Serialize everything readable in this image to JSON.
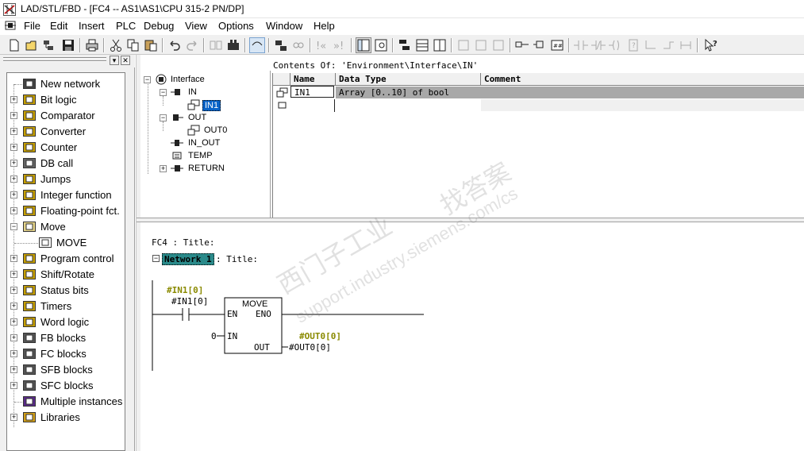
{
  "window": {
    "title": "LAD/STL/FBD  - [FC4 -- AS1\\AS1\\CPU 315-2 PN/DP]",
    "icon": "ladder-app-icon"
  },
  "menu": [
    "File",
    "Edit",
    "Insert",
    "PLC",
    "Debug",
    "View",
    "Options",
    "Window",
    "Help"
  ],
  "toolbar": {
    "icons": [
      "new-icon",
      "open-icon",
      "network-open-icon",
      "save-icon",
      "print-icon",
      "cut-icon",
      "copy-icon",
      "paste-icon",
      "undo-icon",
      "redo-icon",
      "load-icon",
      "station-icon",
      "monitor-icon",
      "online-icon",
      "offline-icon",
      "program-elements-icon",
      "overview-icon",
      "details-icon",
      "split-icon",
      "network-insert-icon",
      "branch-icon",
      "contact-no-icon",
      "contact-nc-icon",
      "coil-icon",
      "box-icon",
      "branch-open-icon",
      "branch-close-icon",
      "help-cursor-icon"
    ]
  },
  "catalog": {
    "items": [
      {
        "label": "New network",
        "icon": "new-network-icon",
        "expander": ""
      },
      {
        "label": "Bit logic",
        "icon": "bit-logic-icon",
        "expander": "+"
      },
      {
        "label": "Comparator",
        "icon": "comparator-icon",
        "expander": "+"
      },
      {
        "label": "Converter",
        "icon": "converter-icon",
        "expander": "+"
      },
      {
        "label": "Counter",
        "icon": "counter-icon",
        "expander": "+"
      },
      {
        "label": "DB call",
        "icon": "db-call-icon",
        "expander": "+"
      },
      {
        "label": "Jumps",
        "icon": "jumps-icon",
        "expander": "+"
      },
      {
        "label": "Integer function",
        "icon": "integer-function-icon",
        "expander": "+"
      },
      {
        "label": "Floating-point fct.",
        "icon": "floating-point-icon",
        "expander": "+"
      },
      {
        "label": "Move",
        "icon": "move-folder-icon",
        "expander": "−"
      },
      {
        "label": "MOVE",
        "icon": "move-block-icon",
        "expander": ""
      },
      {
        "label": "Program control",
        "icon": "program-control-icon",
        "expander": "+"
      },
      {
        "label": "Shift/Rotate",
        "icon": "shift-rotate-icon",
        "expander": "+"
      },
      {
        "label": "Status bits",
        "icon": "status-bits-icon",
        "expander": "+"
      },
      {
        "label": "Timers",
        "icon": "timers-icon",
        "expander": "+"
      },
      {
        "label": "Word logic",
        "icon": "word-logic-icon",
        "expander": "+"
      },
      {
        "label": "FB blocks",
        "icon": "fb-blocks-icon",
        "expander": "+"
      },
      {
        "label": "FC blocks",
        "icon": "fc-blocks-icon",
        "expander": "+"
      },
      {
        "label": "SFB blocks",
        "icon": "sfb-blocks-icon",
        "expander": "+"
      },
      {
        "label": "SFC blocks",
        "icon": "sfc-blocks-icon",
        "expander": "+"
      },
      {
        "label": "Multiple instances",
        "icon": "multiple-instances-icon",
        "expander": ""
      },
      {
        "label": "Libraries",
        "icon": "libraries-icon",
        "expander": "+"
      }
    ]
  },
  "interface": {
    "root": "Interface",
    "nodes": [
      {
        "label": "IN"
      },
      {
        "label": "IN1",
        "selected": true
      },
      {
        "label": "OUT"
      },
      {
        "label": "OUT0"
      },
      {
        "label": "IN_OUT"
      },
      {
        "label": "TEMP"
      },
      {
        "label": "RETURN"
      }
    ]
  },
  "contents": {
    "path": "Contents Of: 'Environment\\Interface\\IN'",
    "columns": [
      "Name",
      "Data Type",
      "Comment"
    ],
    "rows": [
      {
        "name": "IN1",
        "type": "Array [0..10] of bool",
        "comment": ""
      }
    ]
  },
  "editor": {
    "block_title": "FC4 : Title:",
    "network_label": "Network 1",
    "network_title": ": Title:",
    "contact_symbol": "#IN1[0]",
    "contact_address": "#IN1[0]",
    "box_name": "MOVE",
    "pin_en": "EN",
    "pin_eno": "ENO",
    "pin_in": "IN",
    "pin_out": "OUT",
    "in_value": "0",
    "out_symbol": "#OUT0[0]",
    "out_address": "#OUT0[0]"
  },
  "watermark": {
    "text_cn1": "西门子工业",
    "text_cn2": "找答案",
    "text_url": "support.industry.siemens.com/cs"
  }
}
